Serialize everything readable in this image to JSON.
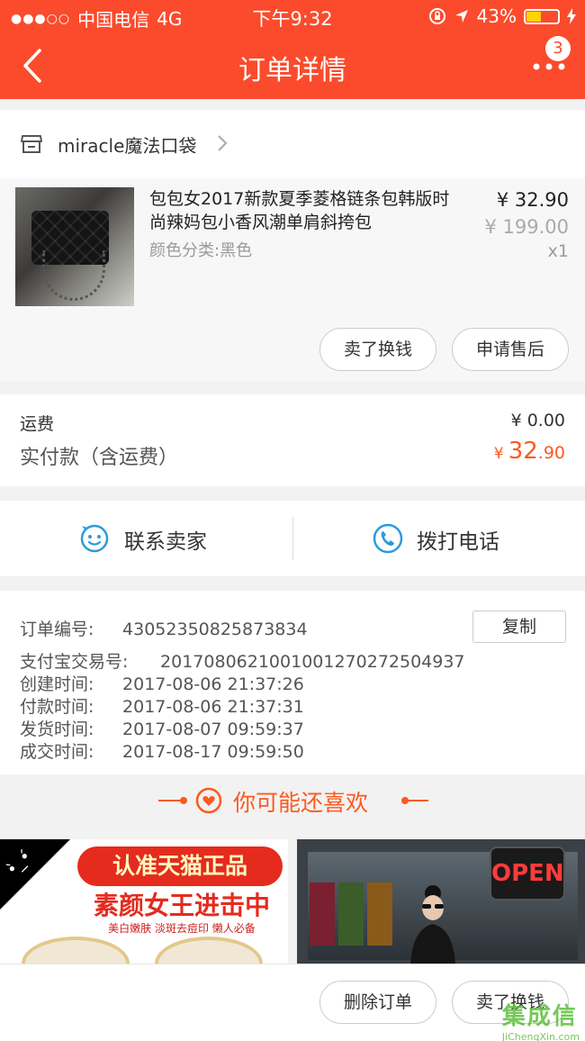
{
  "status_bar": {
    "carrier": "中国电信",
    "network": "4G",
    "time": "下午9:32",
    "battery": "43%"
  },
  "nav": {
    "title": "订单详情",
    "badge_count": "3"
  },
  "shop": {
    "name": "miracle魔法口袋"
  },
  "product": {
    "title": "包包女2017新款夏季菱格链条包韩版时尚辣妈包小香风潮单肩斜挎包",
    "variant": "颜色分类:黑色",
    "price": "¥ 32.90",
    "original_price": "¥ 199.00",
    "quantity": "x1",
    "sell_button": "卖了换钱",
    "after_sale_button": "申请售后"
  },
  "fees": {
    "shipping_label": "运费",
    "shipping_value": "¥ 0.00",
    "paid_label": "实付款（含运费）",
    "paid_currency": "¥",
    "paid_int": "32",
    "paid_dec": ".90"
  },
  "contact": {
    "seller_label": "联系卖家",
    "call_label": "拨打电话"
  },
  "order_info": {
    "order_no_label": "订单编号:",
    "order_no": "43052350825873834",
    "copy_button": "复制",
    "alipay_label": "支付宝交易号:",
    "alipay_no": "2017080621001001270272504937",
    "created_label": "创建时间:",
    "created": "2017-08-06 21:37:26",
    "paid_label": "付款时间:",
    "paid": "2017-08-06 21:37:31",
    "shipped_label": "发货时间:",
    "shipped": "2017-08-07 09:59:37",
    "completed_label": "成交时间:",
    "completed": "2017-08-17 09:59:50"
  },
  "recommend": {
    "title": "你可能还喜欢",
    "card1_line1": "认准天猫正品",
    "card1_line2": "素颜女王进击中",
    "card1_line3": "美白嫩肤 淡斑去痘印 懒人必备",
    "card2_sign": "OPEN"
  },
  "bottom": {
    "delete_button": "删除订单",
    "sell_button": "卖了换钱"
  },
  "watermark": {
    "big": "集成信",
    "small": "JiChengXin.com"
  },
  "colors": {
    "brand": "#fb4b2c",
    "accent_price": "#fb5a1f",
    "link_blue": "#2b9be0"
  }
}
